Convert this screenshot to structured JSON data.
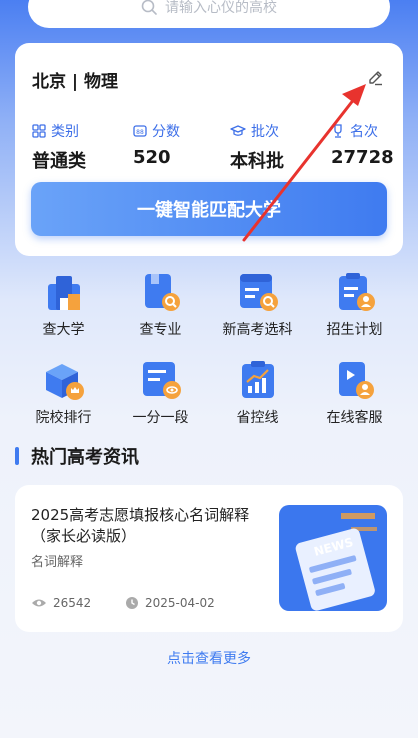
{
  "search": {
    "placeholder": "请输入心仪的高校"
  },
  "profile": {
    "region": "北京 | 物理",
    "stats": [
      {
        "label": "类别",
        "value": "普通类",
        "icon": "category-grid-icon"
      },
      {
        "label": "分数",
        "value": "520",
        "icon": "score-icon"
      },
      {
        "label": "批次",
        "value": "本科批",
        "icon": "graduation-cap-icon"
      },
      {
        "label": "名次",
        "value": "27728",
        "icon": "trophy-icon"
      }
    ],
    "match_button": "一键智能匹配大学"
  },
  "features": [
    {
      "label": "查大学",
      "icon": "university-icon"
    },
    {
      "label": "查专业",
      "icon": "major-search-icon"
    },
    {
      "label": "新高考选科",
      "icon": "subject-select-icon"
    },
    {
      "label": "招生计划",
      "icon": "enrollment-plan-icon"
    },
    {
      "label": "院校排行",
      "icon": "ranking-box-icon"
    },
    {
      "label": "一分一段",
      "icon": "score-segment-icon"
    },
    {
      "label": "省控线",
      "icon": "control-line-chart-icon"
    },
    {
      "label": "在线客服",
      "icon": "customer-service-icon"
    }
  ],
  "news_section": {
    "title": "热门高考资讯",
    "items": [
      {
        "title": "2025高考志愿填报核心名词解释（家长必读版）",
        "category": "名词解释",
        "views": "26542",
        "date": "2025-04-02",
        "thumb_text": "NEWS"
      }
    ],
    "more": "点击查看更多"
  },
  "colors": {
    "accent": "#3f7bf0",
    "annotation_arrow": "#e8332e"
  }
}
